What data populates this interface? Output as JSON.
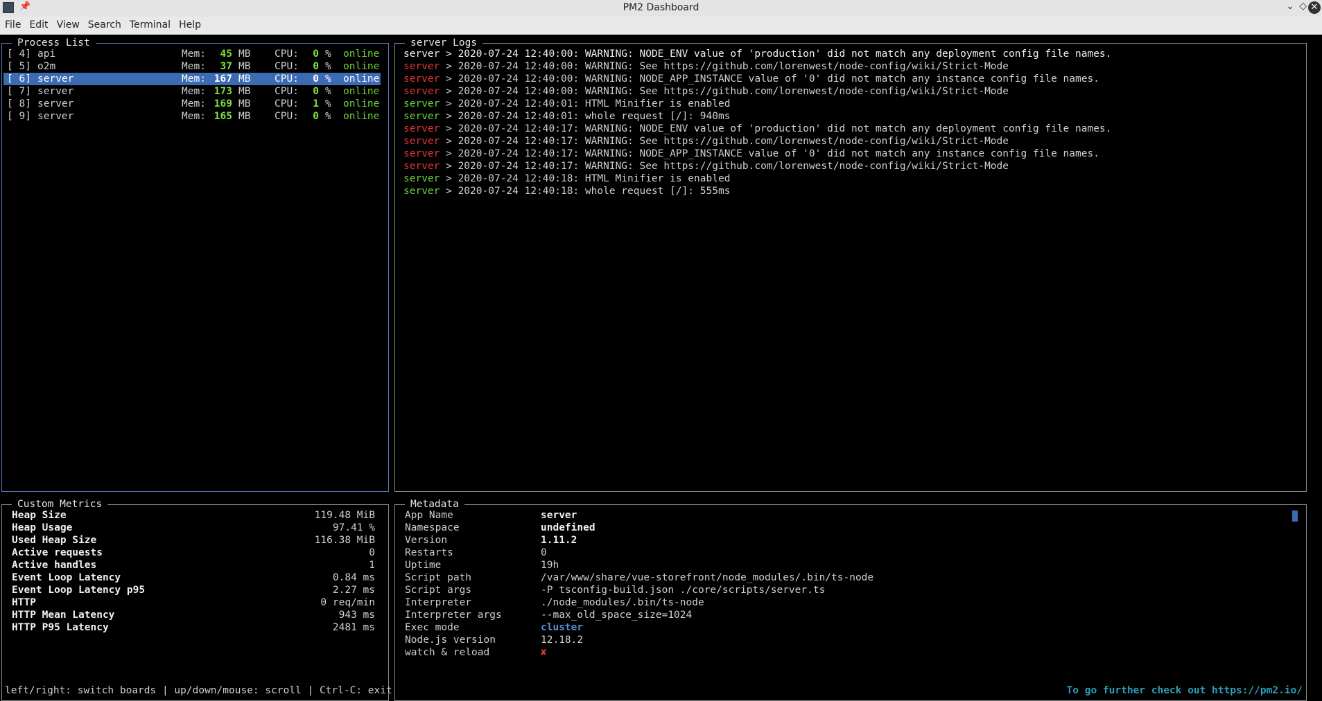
{
  "window": {
    "title": "PM2 Dashboard"
  },
  "menu": [
    "File",
    "Edit",
    "View",
    "Search",
    "Terminal",
    "Help"
  ],
  "process_list": {
    "label": "Process List",
    "mem_label": "Mem:",
    "mem_unit": "MB",
    "cpu_label": "CPU:",
    "cpu_unit": "%",
    "items": [
      {
        "id": "[ 4]",
        "name": "api",
        "mem": "45",
        "cpu": "0",
        "status": "online"
      },
      {
        "id": "[ 5]",
        "name": "o2m",
        "mem": "37",
        "cpu": "0",
        "status": "online"
      },
      {
        "id": "[ 6]",
        "name": "server",
        "mem": "167",
        "cpu": "0",
        "status": "online"
      },
      {
        "id": "[ 7]",
        "name": "server",
        "mem": "173",
        "cpu": "0",
        "status": "online"
      },
      {
        "id": "[ 8]",
        "name": "server",
        "mem": "169",
        "cpu": "1",
        "status": "online"
      },
      {
        "id": "[ 9]",
        "name": "server",
        "mem": "165",
        "cpu": "0",
        "status": "online"
      }
    ],
    "selected_index": 2
  },
  "logs": {
    "label": "server Logs",
    "lines": [
      {
        "src": "server",
        "tone": "white",
        "text": " > 2020-07-24 12:40:00: WARNING: NODE_ENV value of 'production' did not match any deployment config file names."
      },
      {
        "src": "server",
        "tone": "red",
        "text": " > 2020-07-24 12:40:00: WARNING: See https://github.com/lorenwest/node-config/wiki/Strict-Mode"
      },
      {
        "src": "server",
        "tone": "red",
        "text": " > 2020-07-24 12:40:00: WARNING: NODE_APP_INSTANCE value of '0' did not match any instance config file names."
      },
      {
        "src": "server",
        "tone": "red",
        "text": " > 2020-07-24 12:40:00: WARNING: See https://github.com/lorenwest/node-config/wiki/Strict-Mode"
      },
      {
        "src": "server",
        "tone": "green",
        "text": " > 2020-07-24 12:40:01: HTML Minifier is enabled"
      },
      {
        "src": "server",
        "tone": "green",
        "text": " > 2020-07-24 12:40:01: whole request [/]: 940ms"
      },
      {
        "src": "server",
        "tone": "red",
        "text": " > 2020-07-24 12:40:17: WARNING: NODE_ENV value of 'production' did not match any deployment config file names."
      },
      {
        "src": "server",
        "tone": "red",
        "text": " > 2020-07-24 12:40:17: WARNING: See https://github.com/lorenwest/node-config/wiki/Strict-Mode"
      },
      {
        "src": "server",
        "tone": "red",
        "text": " > 2020-07-24 12:40:17: WARNING: NODE_APP_INSTANCE value of '0' did not match any instance config file names."
      },
      {
        "src": "server",
        "tone": "red",
        "text": " > 2020-07-24 12:40:17: WARNING: See https://github.com/lorenwest/node-config/wiki/Strict-Mode"
      },
      {
        "src": "server",
        "tone": "green",
        "text": " > 2020-07-24 12:40:18: HTML Minifier is enabled"
      },
      {
        "src": "server",
        "tone": "green",
        "text": " > 2020-07-24 12:40:18: whole request [/]: 555ms"
      }
    ]
  },
  "custom_metrics": {
    "label": "Custom Metrics",
    "items": [
      {
        "key": "Heap Size",
        "value": "119.48 MiB"
      },
      {
        "key": "Heap Usage",
        "value": "97.41 %"
      },
      {
        "key": "Used Heap Size",
        "value": "116.38 MiB"
      },
      {
        "key": "Active requests",
        "value": "0"
      },
      {
        "key": "Active handles",
        "value": "1"
      },
      {
        "key": "Event Loop Latency",
        "value": "0.84 ms"
      },
      {
        "key": "Event Loop Latency p95",
        "value": "2.27 ms"
      },
      {
        "key": "HTTP",
        "value": "0 req/min"
      },
      {
        "key": "HTTP Mean Latency",
        "value": "943 ms"
      },
      {
        "key": "HTTP P95 Latency",
        "value": "2481 ms"
      }
    ]
  },
  "metadata": {
    "label": "Metadata",
    "items": [
      {
        "key": "App Name",
        "value": "server",
        "style": "bold"
      },
      {
        "key": "Namespace",
        "value": "undefined",
        "style": "bold"
      },
      {
        "key": "Version",
        "value": "1.11.2",
        "style": "bold"
      },
      {
        "key": "Restarts",
        "value": "0",
        "style": "plain"
      },
      {
        "key": "Uptime",
        "value": "19h",
        "style": "plain"
      },
      {
        "key": "Script path",
        "value": "/var/www/share/vue-storefront/node_modules/.bin/ts-node",
        "style": "plain"
      },
      {
        "key": "Script args",
        "value": "-P tsconfig-build.json ./core/scripts/server.ts",
        "style": "plain"
      },
      {
        "key": "Interpreter",
        "value": "./node_modules/.bin/ts-node",
        "style": "plain"
      },
      {
        "key": "Interpreter args",
        "value": "--max_old_space_size=1024",
        "style": "plain"
      },
      {
        "key": "Exec mode",
        "value": "cluster",
        "style": "blue"
      },
      {
        "key": "Node.js version",
        "value": "12.18.2",
        "style": "plain"
      },
      {
        "key": "watch & reload",
        "value": "✘",
        "style": "red"
      }
    ]
  },
  "footer": {
    "help": "left/right: switch boards | up/down/mouse: scroll | Ctrl-C: exit",
    "link": "To go further check out https://pm2.io/"
  },
  "colors": {
    "selection": "#3b6bb3",
    "online": "#6bd43a",
    "error": "#e53535",
    "link": "#2a9fb8"
  }
}
